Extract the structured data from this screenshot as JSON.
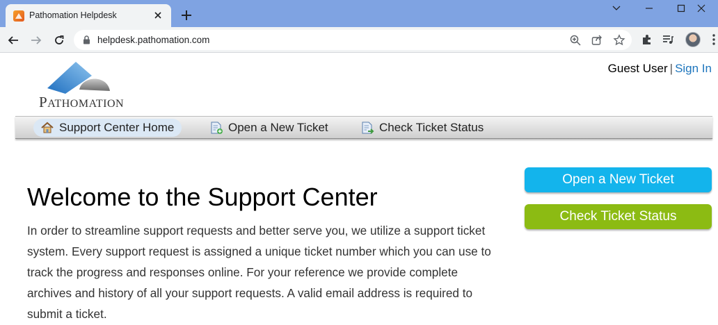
{
  "browser": {
    "tab_title": "Pathomation Helpdesk",
    "url": "helpdesk.pathomation.com"
  },
  "header": {
    "logo_text_first": "P",
    "logo_text_rest": "ATHOMATION",
    "guest_label": "Guest User",
    "separator": "|",
    "sign_in_label": "Sign In"
  },
  "nav": {
    "items": [
      {
        "label": "Support Center Home",
        "icon": "home-icon",
        "active": true
      },
      {
        "label": "Open a New Ticket",
        "icon": "new-ticket-icon",
        "active": false
      },
      {
        "label": "Check Ticket Status",
        "icon": "ticket-status-icon",
        "active": false
      }
    ]
  },
  "main": {
    "title": "Welcome to the Support Center",
    "intro": "In order to streamline support requests and better serve you, we utilize a support ticket system. Every support request is assigned a unique ticket number which you can use to track the progress and responses online. For your reference we provide complete archives and history of all your support requests. A valid email address is required to submit a ticket."
  },
  "sidebar": {
    "open_ticket_label": "Open a New Ticket",
    "check_status_label": "Check Ticket Status"
  },
  "colors": {
    "tabstrip": "#7fa3e2",
    "link": "#1d75bd",
    "blue_button": "#13b4ec",
    "green_button": "#8cbb13",
    "nav_active": "#dbe8f5"
  }
}
